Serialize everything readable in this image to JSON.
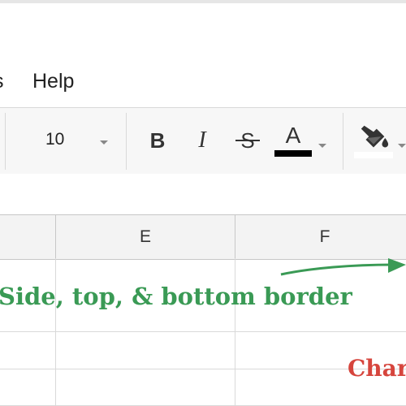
{
  "menu": {
    "partial_item": "s",
    "help_label": "Help"
  },
  "toolbar": {
    "font_size": "10",
    "bold_label": "B",
    "italic_label": "I",
    "strikethrough_label": "S",
    "text_color_label": "A",
    "text_color": "#000000",
    "fill_color": "#ffffff",
    "icons": [
      "bold-icon",
      "italic-icon",
      "strikethrough-icon",
      "text-color-icon",
      "fill-color-icon"
    ]
  },
  "grid": {
    "column_headers": [
      "E",
      "F"
    ]
  },
  "annotations": {
    "green_text": "Side, top, & bottom border",
    "green_color": "#3a9a55",
    "red_text": "Char",
    "red_color": "#d6453d"
  }
}
